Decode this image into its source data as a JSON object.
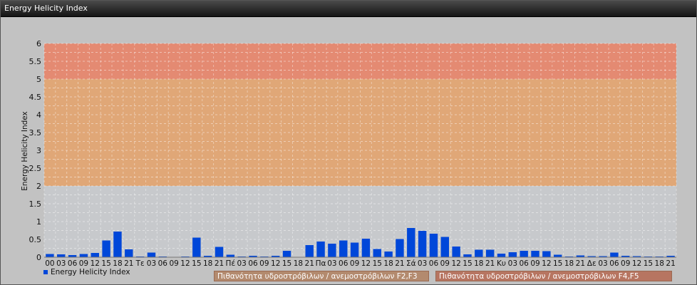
{
  "window": {
    "title": "Energy Helicity Index"
  },
  "legend": {
    "series_label": "Energy Helicity Index",
    "bands": [
      {
        "label": "Πιθανότητα υδροστρόβιλων / ανεμοστρόβιλων F2,F3",
        "color": "#b38a6e"
      },
      {
        "label": "Πιθανότητα υδροστρόβιλων / ανεμοστρόβιλων F4,F5",
        "color": "#b77561"
      }
    ]
  },
  "chart_data": {
    "type": "bar",
    "title": "",
    "ylabel": "Energy Helicity Index",
    "xlabel": "",
    "ylim": [
      0,
      6
    ],
    "yticks": [
      "0",
      "0.5",
      "1",
      "1.5",
      "2",
      "2.5",
      "3",
      "3.5",
      "4",
      "4.5",
      "5",
      "5.5",
      "6"
    ],
    "grid": true,
    "legend_position": "bottom",
    "bands": [
      {
        "from": 2,
        "to": 5,
        "color": "#e0a777"
      },
      {
        "from": 5,
        "to": 6,
        "color": "#e48a72"
      }
    ],
    "bar_color": "#0047d9",
    "categories": [
      "00",
      "03",
      "06",
      "09",
      "12",
      "15",
      "18",
      "21",
      "Τε",
      "03",
      "06",
      "09",
      "12",
      "15",
      "18",
      "21",
      "Πέ",
      "03",
      "06",
      "09",
      "12",
      "15",
      "18",
      "21",
      "Πα",
      "03",
      "06",
      "09",
      "12",
      "15",
      "18",
      "21",
      "Σά",
      "03",
      "06",
      "09",
      "12",
      "15",
      "18",
      "21",
      "Κυ",
      "03",
      "06",
      "09",
      "12",
      "15",
      "18",
      "21",
      "Δε",
      "03",
      "06",
      "09",
      "12",
      "15",
      "18",
      "21"
    ],
    "series": [
      {
        "name": "Energy Helicity Index",
        "values": [
          0.09,
          0.08,
          0.06,
          0.09,
          0.12,
          0.47,
          0.72,
          0.22,
          0.02,
          0.13,
          0.02,
          0.01,
          0.02,
          0.55,
          0.04,
          0.29,
          0.07,
          0.02,
          0.04,
          0.02,
          0.04,
          0.18,
          0.0,
          0.34,
          0.44,
          0.38,
          0.47,
          0.41,
          0.52,
          0.23,
          0.16,
          0.51,
          0.82,
          0.74,
          0.66,
          0.57,
          0.3,
          0.08,
          0.21,
          0.21,
          0.1,
          0.14,
          0.18,
          0.18,
          0.17,
          0.07,
          0.02,
          0.05,
          0.03,
          0.03,
          0.13,
          0.04,
          0.03,
          0.02,
          0.02,
          0.04
        ]
      }
    ]
  }
}
